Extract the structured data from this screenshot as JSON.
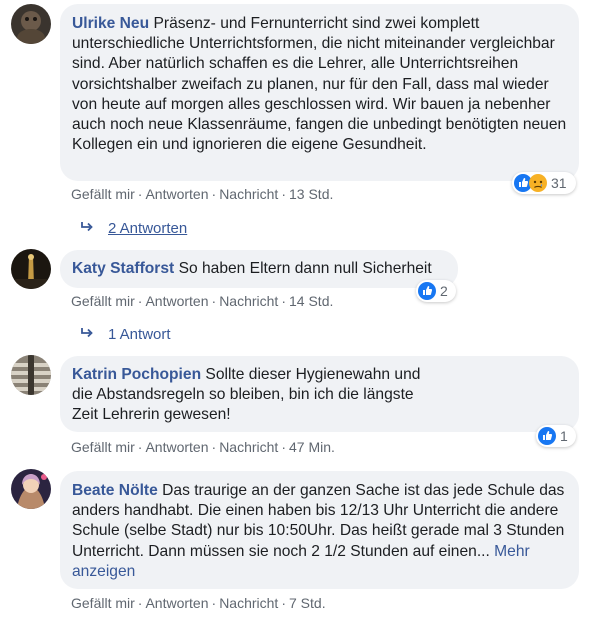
{
  "colors": {
    "link": "#385898",
    "meta": "#606770",
    "bubble": "#f0f2f5",
    "like_blue": "#1877f2"
  },
  "comments": [
    {
      "author": "Ulrike Neu",
      "text": " Präsenz- und Fernunterricht sind zwei komplett unterschiedliche Unterrichtsformen, die nicht miteinander vergleichbar sind. Aber natürlich schaffen es die Lehrer, alle Unterrichtsreihen vorsichtshalber zweifach zu planen, nur für den Fall, dass mal wieder von heute auf morgen alles geschlossen wird. Wir bauen ja nebenher auch noch neue Klassenräume, fangen die unbedingt benötigten neuen Kollegen ein und ignorieren die eigene Gesundheit.",
      "reaction_icons": [
        "like-icon",
        "sad-icon"
      ],
      "reaction_count": "31",
      "actions": {
        "like": "Gefällt mir",
        "reply": "Antworten",
        "message": "Nachricht",
        "time": "13 Std."
      },
      "replies": "2 Antworten"
    },
    {
      "author": "Katy Stafforst",
      "text": " So haben Eltern dann null Sicherheit",
      "reaction_icons": [
        "like-icon"
      ],
      "reaction_count": "2",
      "actions": {
        "like": "Gefällt mir",
        "reply": "Antworten",
        "message": "Nachricht",
        "time": "14 Std."
      },
      "replies": "1 Antwort"
    },
    {
      "author": "Katrin Pochopien",
      "text": " Sollte dieser Hygienewahn und die Abstandsregeln so bleiben, bin ich die längste Zeit Lehrerin gewesen!",
      "reaction_icons": [
        "like-icon"
      ],
      "reaction_count": "1",
      "actions": {
        "like": "Gefällt mir",
        "reply": "Antworten",
        "message": "Nachricht",
        "time": "47 Min."
      }
    },
    {
      "author": "Beate Nölte",
      "text": " Das traurige an der ganzen Sache ist das jede Schule das anders handhabt. Die einen haben bis 12/13 Uhr Unterricht die andere Schule (selbe Stadt) nur bis 10:50Uhr. Das heißt gerade mal 3 Stunden Unterricht. Dann müssen sie noch 2 1/2 Stunden auf einen...",
      "more": " Mehr anzeigen",
      "actions": {
        "like": "Gefällt mir",
        "reply": "Antworten",
        "message": "Nachricht",
        "time": "7 Std."
      }
    }
  ]
}
